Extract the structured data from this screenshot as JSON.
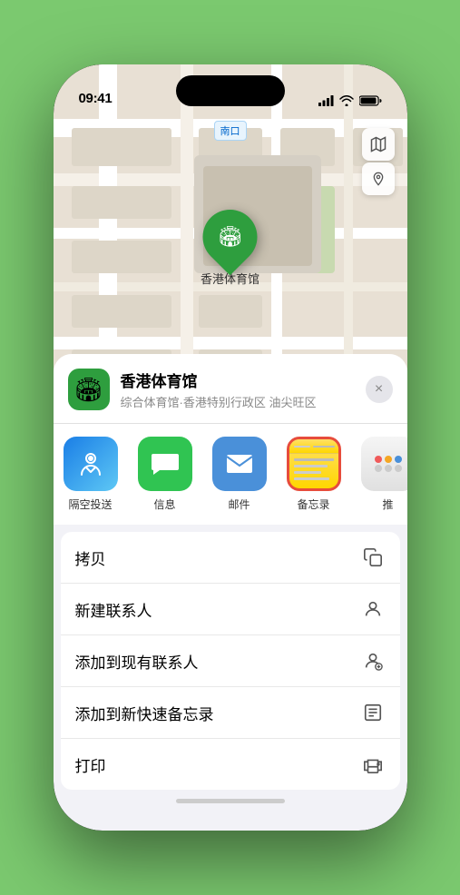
{
  "statusBar": {
    "time": "09:41",
    "locationIcon": true
  },
  "map": {
    "label": "南口",
    "markerLabel": "香港体育馆"
  },
  "placeCard": {
    "name": "香港体育馆",
    "subtitle": "综合体育馆·香港特别行政区 油尖旺区",
    "closeLabel": "×"
  },
  "shareApps": [
    {
      "id": "airdrop",
      "label": "隔空投送",
      "type": "airdrop"
    },
    {
      "id": "messages",
      "label": "信息",
      "type": "messages"
    },
    {
      "id": "mail",
      "label": "邮件",
      "type": "mail"
    },
    {
      "id": "notes",
      "label": "备忘录",
      "type": "notes"
    },
    {
      "id": "more",
      "label": "推",
      "type": "more"
    }
  ],
  "actionRows": [
    {
      "id": "copy",
      "label": "拷贝",
      "icon": "copy"
    },
    {
      "id": "new-contact",
      "label": "新建联系人",
      "icon": "person-plus"
    },
    {
      "id": "add-existing",
      "label": "添加到现有联系人",
      "icon": "person-circle"
    },
    {
      "id": "quick-note",
      "label": "添加到新快速备忘录",
      "icon": "note"
    },
    {
      "id": "print",
      "label": "打印",
      "icon": "printer"
    }
  ],
  "colors": {
    "green": "#2e9e3e",
    "notesBorder": "#e74c3c",
    "notesTop": "#ffe066",
    "notesBottom": "#ffd700",
    "moreDot1": "#f05a5a",
    "moreDot2": "#f5a623",
    "moreDot3": "#4a90d9"
  }
}
